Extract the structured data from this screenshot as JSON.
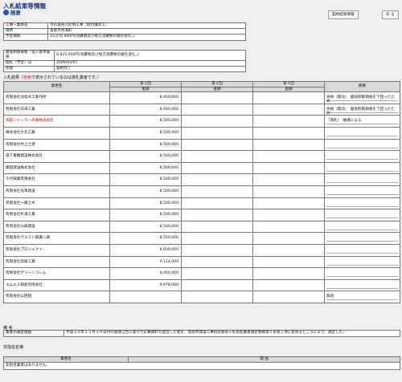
{
  "header": {
    "title": "入札結果等情報",
    "subtitle": "随意"
  },
  "buttons": {
    "contract_info": "契約結果情報",
    "back": "戻 る"
  },
  "info": [
    {
      "label": "工事・業務名",
      "value": "市の森谷川砂防工事（取付護岸工）"
    },
    {
      "label": "場所",
      "value": "島取市丙海町"
    },
    {
      "label": "予定価格",
      "value": "10,476,900円(消費税及び地方消費税の額を含む。)"
    }
  ],
  "info2": [
    {
      "label": "最低制限価格／低入基準価格",
      "value": "8,825,000円(消費税及び地方消費税の額を含む。)"
    },
    {
      "label": "開札（予定）日",
      "value": "2009/03/07"
    },
    {
      "label": "状態",
      "value": "契約完了"
    }
  ],
  "bidders_section": {
    "prefix": "入札結果（",
    "red": "赤色",
    "suffix": "で表示されているのは落札業者です。）"
  },
  "table": {
    "col_name": "業者名",
    "round1": "第１回",
    "round2": "第２回",
    "round3": "第３回",
    "amount": "金額",
    "remarks": "摘要"
  },
  "rows": [
    {
      "name": "有限会社池島木工製作所",
      "amount": "8,400,000",
      "remark": "失格（無効）　最低制限価格を下回ったため",
      "winner": false
    },
    {
      "name": "有限会社日海工業",
      "amount": "8,400,000",
      "remark": "失格（無効）　最低制限価格を下回ったため",
      "winner": false
    },
    {
      "name": "鳥取シャッター商事株式会社",
      "amount": "8,500,000",
      "remark": "［落札］　抽選による",
      "winner": true
    },
    {
      "name": "株式会社大北工業",
      "amount": "8,500,000",
      "remark": "",
      "winner": false
    },
    {
      "name": "有限会社村上土建",
      "amount": "8,500,000",
      "remark": "",
      "winner": false
    },
    {
      "name": "森下重機建設株式会社",
      "amount": "8,500,000",
      "remark": "",
      "winner": false
    },
    {
      "name": "藤田建設株式会社",
      "amount": "8,500,000",
      "remark": "",
      "winner": false
    },
    {
      "name": "千代興業有限会社",
      "amount": "8,500,000",
      "remark": "",
      "winner": false
    },
    {
      "name": "有限会社光幸建設",
      "amount": "8,500,000",
      "remark": "",
      "winner": false
    },
    {
      "name": "有限会社一興土木",
      "amount": "8,500,000",
      "remark": "",
      "winner": false
    },
    {
      "name": "有限会社杉浦工業",
      "amount": "8,500,000",
      "remark": "",
      "winner": false
    },
    {
      "name": "有限会社山辰建設",
      "amount": "8,500,000",
      "remark": "",
      "winner": false
    },
    {
      "name": "有限会社ウエスト興業八頭",
      "amount": "8,550,000",
      "remark": "",
      "winner": false
    },
    {
      "name": "有限会社プロジェクト",
      "amount": "8,600,000",
      "remark": "",
      "winner": false
    },
    {
      "name": "有限会社高尾工業",
      "amount": "9,114,000",
      "remark": "",
      "winner": false
    },
    {
      "name": "有限会社グリーンコーム",
      "amount": "9,400,000",
      "remark": "",
      "winner": false
    },
    {
      "name": "エムエス興産有限会社",
      "amount": "9,978,000",
      "remark": "",
      "winner": false
    },
    {
      "name": "有限会社山西組",
      "amount": "",
      "remark": "辞退",
      "winner": false
    }
  ],
  "notes": {
    "heading": "備 考",
    "label": "業者の選定理由",
    "value": "平成２０年１２月１９日付の調達公告に基づき応募資料を提出した者を、島取県建設工事指名競争入札指名業者選定要綱第５条第１項に定めるところにより、選定した。"
  },
  "invalid": {
    "heading": "非指名名簿",
    "col_name": "業者名",
    "col_reason": "理 由",
    "empty": "非指名業者はありません。"
  }
}
